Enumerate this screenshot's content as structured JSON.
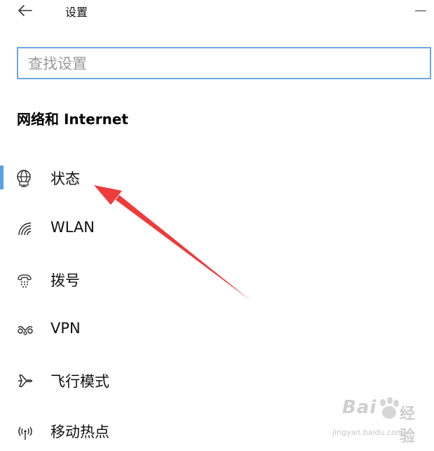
{
  "window": {
    "title": "设置"
  },
  "search": {
    "placeholder": "查找设置",
    "value": ""
  },
  "section": {
    "heading": "网络和 Internet"
  },
  "nav": {
    "items": [
      {
        "label": "状态",
        "icon": "globe-status-icon",
        "selected": true
      },
      {
        "label": "WLAN",
        "icon": "wifi-icon",
        "selected": false
      },
      {
        "label": "拨号",
        "icon": "dialup-phone-icon",
        "selected": false
      },
      {
        "label": "VPN",
        "icon": "vpn-icon",
        "selected": false
      },
      {
        "label": "飞行模式",
        "icon": "airplane-icon",
        "selected": false
      },
      {
        "label": "移动热点",
        "icon": "hotspot-icon",
        "selected": false
      }
    ]
  },
  "colors": {
    "accent": "#5aa0e6",
    "search_border": "#6aa8e3",
    "annotation_arrow": "#ee3b3b"
  },
  "watermark": {
    "brand": "Bai",
    "brand_cn": "经验",
    "url": "jingyan.baidu.com"
  }
}
